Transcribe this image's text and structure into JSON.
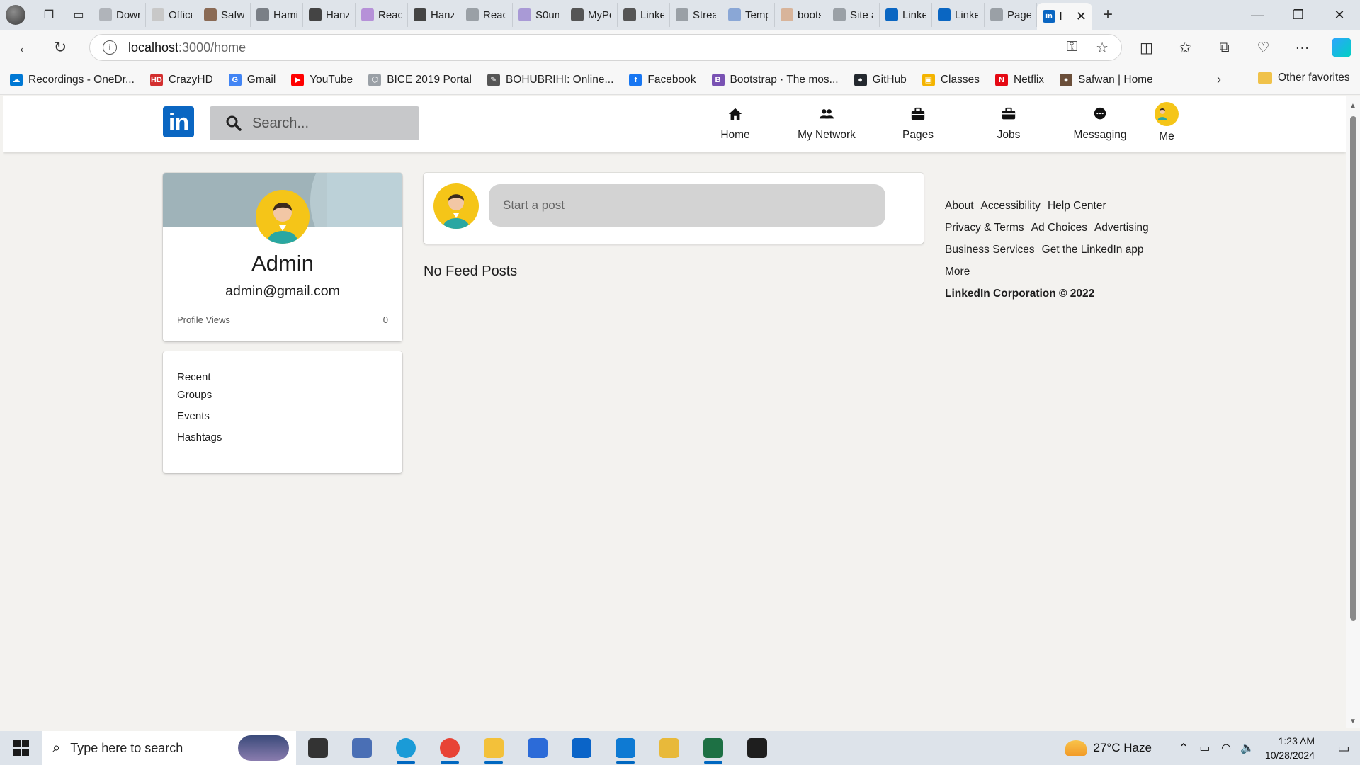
{
  "browser": {
    "tabs": [
      {
        "label": "Dowr",
        "icon": "gear-icon",
        "color": "#b0b4ba"
      },
      {
        "label": "Office",
        "icon": "document-icon",
        "color": "#c8c8c8"
      },
      {
        "label": "Safwa",
        "icon": "avatar-icon",
        "color": "#8a6a55"
      },
      {
        "label": "Hami",
        "icon": "w-icon",
        "color": "#7a7f86"
      },
      {
        "label": "Hanz",
        "icon": "code-icon",
        "color": "#444444"
      },
      {
        "label": "React",
        "icon": "v-icon",
        "color": "#b691d8"
      },
      {
        "label": "Hanz",
        "icon": "code-icon",
        "color": "#444444"
      },
      {
        "label": "React",
        "icon": "page-icon",
        "color": "#9aa0a6"
      },
      {
        "label": "S0um",
        "icon": "globe-icon",
        "color": "#a99ad6"
      },
      {
        "label": "MyPo",
        "icon": "github-icon",
        "color": "#555555"
      },
      {
        "label": "Linke",
        "icon": "github-icon",
        "color": "#555555"
      },
      {
        "label": "Strea",
        "icon": "page-icon",
        "color": "#9aa0a6"
      },
      {
        "label": "Temp",
        "icon": "search-icon",
        "color": "#8aa7d6"
      },
      {
        "label": "boots",
        "icon": "person-icon",
        "color": "#d8b49a"
      },
      {
        "label": "Site a",
        "icon": "page-icon",
        "color": "#9aa0a6"
      },
      {
        "label": "Linke",
        "icon": "linkedin-icon",
        "color": "#0a66c2"
      },
      {
        "label": "Linke",
        "icon": "linkedin-icon",
        "color": "#0a66c2"
      },
      {
        "label": "Page",
        "icon": "page-icon",
        "color": "#9aa0a6"
      }
    ],
    "active_tab": {
      "label": "l",
      "icon": "linkedin-icon"
    },
    "url_host": "localhost",
    "url_path": ":3000/home",
    "bookmarks": [
      {
        "label": "Recordings - OneDr...",
        "icon": "onedrive-icon",
        "color": "#0078d4",
        "glyph": "☁"
      },
      {
        "label": "CrazyHD",
        "icon": "hd-icon",
        "color": "#d32f2f",
        "glyph": "HD"
      },
      {
        "label": "Gmail",
        "icon": "google-icon",
        "color": "#4285f4",
        "glyph": "G"
      },
      {
        "label": "YouTube",
        "icon": "youtube-icon",
        "color": "#ff0000",
        "glyph": "▶"
      },
      {
        "label": "BICE 2019 Portal",
        "icon": "hexagon-icon",
        "color": "#9aa0a6",
        "glyph": "⬡"
      },
      {
        "label": "BOHUBRIHI: Online...",
        "icon": "pen-icon",
        "color": "#555555",
        "glyph": "✎"
      },
      {
        "label": "Facebook",
        "icon": "facebook-icon",
        "color": "#1877f2",
        "glyph": "f"
      },
      {
        "label": "Bootstrap · The mos...",
        "icon": "bootstrap-icon",
        "color": "#7952b3",
        "glyph": "B"
      },
      {
        "label": "GitHub",
        "icon": "github-icon",
        "color": "#24292f",
        "glyph": "●"
      },
      {
        "label": "Classes",
        "icon": "classroom-icon",
        "color": "#f4b400",
        "glyph": "▣"
      },
      {
        "label": "Netflix",
        "icon": "netflix-icon",
        "color": "#e50914",
        "glyph": "N"
      },
      {
        "label": "Safwan | Home",
        "icon": "avatar-icon",
        "color": "#6b4f3a",
        "glyph": "●"
      }
    ],
    "other_favorites": "Other favorites"
  },
  "header": {
    "logo": "in",
    "search_placeholder": "Search...",
    "nav": [
      {
        "label": "Home",
        "icon": "home-icon"
      },
      {
        "label": "My Network",
        "icon": "network-icon"
      },
      {
        "label": "Pages",
        "icon": "briefcase-icon"
      },
      {
        "label": "Jobs",
        "icon": "jobs-icon"
      },
      {
        "label": "Messaging",
        "icon": "messaging-icon"
      },
      {
        "label": "Me",
        "icon": "avatar-icon"
      }
    ]
  },
  "profile": {
    "name": "Admin",
    "email": "admin@gmail.com",
    "views_label": "Profile Views",
    "views_value": "0"
  },
  "sidebar": {
    "items": [
      "Recent",
      "Groups",
      "Events",
      "Hashtags"
    ]
  },
  "feed": {
    "post_placeholder": "Start a post",
    "empty_text": "No Feed Posts"
  },
  "footer": {
    "rows": [
      [
        "About",
        "Accessibility",
        "Help Center"
      ],
      [
        "Privacy & Terms",
        "Ad Choices",
        "Advertising"
      ],
      [
        "Business Services",
        "Get the LinkedIn app"
      ],
      [
        "More"
      ]
    ],
    "corporation": "LinkedIn Corporation © 2022"
  },
  "taskbar": {
    "search_placeholder": "Type here to search",
    "apps": [
      {
        "name": "task-view",
        "color": "#333333"
      },
      {
        "name": "file-app",
        "color": "#4a6fb5"
      },
      {
        "name": "edge",
        "color": "#1a9bd7"
      },
      {
        "name": "chrome",
        "color": "#e84335"
      },
      {
        "name": "file-explorer",
        "color": "#f3c13a"
      },
      {
        "name": "store",
        "color": "#2c6bd8"
      },
      {
        "name": "outlook",
        "color": "#0a64c8"
      },
      {
        "name": "vscode",
        "color": "#0e7ad3"
      },
      {
        "name": "paint",
        "color": "#e8b93a"
      },
      {
        "name": "excel",
        "color": "#1d7044"
      },
      {
        "name": "terminal",
        "color": "#1e1e1e"
      }
    ],
    "weather": "27°C  Haze",
    "time": "1:23 AM",
    "date": "10/28/2024"
  }
}
